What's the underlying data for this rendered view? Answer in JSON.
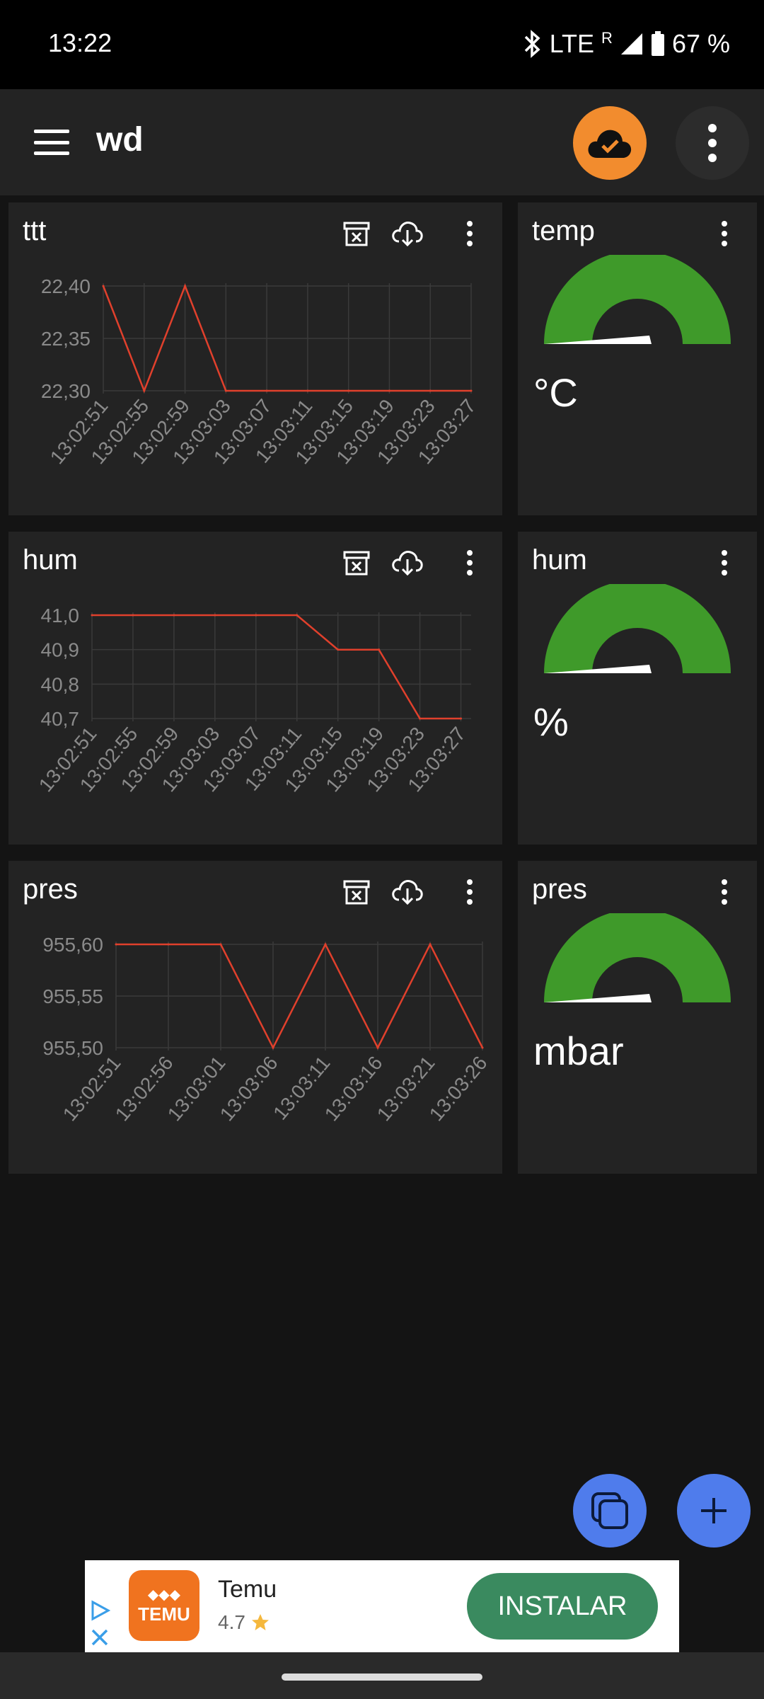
{
  "status": {
    "time": "13:22",
    "network": "LTE",
    "roaming": "R",
    "battery": "67 %"
  },
  "app": {
    "title": "wd"
  },
  "icons": {
    "menu": "hamburger-icon",
    "cloud": "cloud-check-icon",
    "more": "more-vert-icon",
    "clear": "archive-clear-icon",
    "download": "cloud-download-icon",
    "copy": "copy-icon",
    "add": "plus-icon"
  },
  "colors": {
    "accent": "#f28c2e",
    "fab": "#4f7cec",
    "line": "#e0402c",
    "gauge": "#3f9a2a",
    "install": "#3a8a5f"
  },
  "widgets": {
    "chart1": {
      "title": "ttt"
    },
    "chart2": {
      "title": "hum"
    },
    "chart3": {
      "title": "pres"
    },
    "gauge1": {
      "title": "temp",
      "unit": "°C",
      "value_fraction": 0
    },
    "gauge2": {
      "title": "hum",
      "unit": "%",
      "value_fraction": 0
    },
    "gauge3": {
      "title": "pres",
      "unit": "mbar",
      "value_fraction": 0
    }
  },
  "chart_data": [
    {
      "type": "line",
      "title": "ttt",
      "x": [
        "13:02:51",
        "13:02:55",
        "13:02:59",
        "13:03:03",
        "13:03:07",
        "13:03:11",
        "13:03:15",
        "13:03:19",
        "13:03:23",
        "13:03:27"
      ],
      "x_numeric": [
        0,
        4,
        8,
        12,
        16,
        20,
        24,
        28,
        32,
        36
      ],
      "y": [
        22.4,
        22.3,
        22.4,
        22.3,
        22.3,
        22.3,
        22.3,
        22.3,
        22.3,
        22.3
      ],
      "yticks": [
        "22,40",
        "22,35",
        "22,30"
      ],
      "ylim": [
        22.3,
        22.4
      ],
      "xlim": [
        0,
        36
      ],
      "grid": true
    },
    {
      "type": "line",
      "title": "hum",
      "x": [
        "13:02:51",
        "13:02:55",
        "13:02:59",
        "13:03:03",
        "13:03:07",
        "13:03:11",
        "13:03:15",
        "13:03:19",
        "13:03:23",
        "13:03:27"
      ],
      "x_numeric": [
        0,
        4,
        8,
        12,
        16,
        20,
        24,
        28,
        32,
        36
      ],
      "y": [
        41.0,
        41.0,
        41.0,
        41.0,
        41.0,
        41.0,
        40.9,
        40.9,
        40.7,
        40.7
      ],
      "yticks": [
        "41,0",
        "40,9",
        "40,8",
        "40,7"
      ],
      "ylim": [
        40.7,
        41.0
      ],
      "xlim": [
        0,
        37
      ],
      "grid": true
    },
    {
      "type": "line",
      "title": "pres",
      "x": [
        "13:02:51",
        "13:02:56",
        "13:03:01",
        "13:03:06",
        "13:03:11",
        "13:03:16",
        "13:03:21",
        "13:03:26"
      ],
      "x_numeric": [
        0,
        5,
        10,
        15,
        20,
        25,
        30,
        35
      ],
      "y": [
        955.6,
        955.6,
        955.6,
        955.5,
        955.6,
        955.5,
        955.6,
        955.5
      ],
      "yticks": [
        "955,60",
        "955,55",
        "955,50"
      ],
      "ylim": [
        955.5,
        955.6
      ],
      "xlim": [
        0,
        35
      ],
      "grid": true
    }
  ],
  "ad": {
    "name": "Temu",
    "rating": "4.7",
    "install": "INSTALAR",
    "logo_text": "TEMU"
  }
}
